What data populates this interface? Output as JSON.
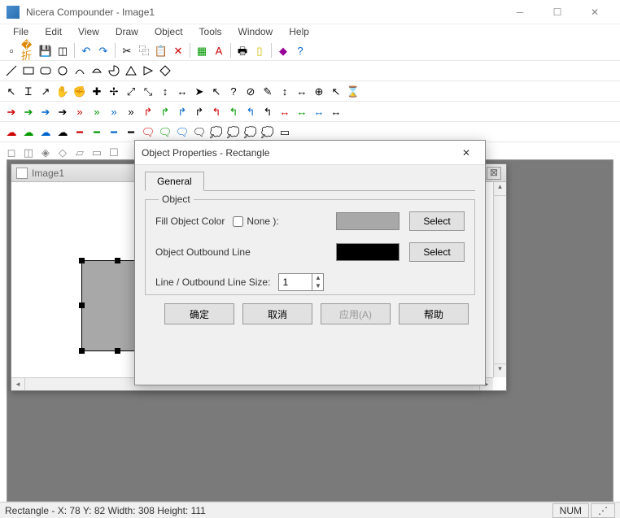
{
  "window": {
    "title": "Nicera Compounder - Image1"
  },
  "menu": {
    "items": [
      "File",
      "Edit",
      "View",
      "Draw",
      "Object",
      "Tools",
      "Window",
      "Help"
    ]
  },
  "child": {
    "title": "Image1"
  },
  "dialog": {
    "title": "Object Properties - Rectangle",
    "tab": "General",
    "fieldset": "Object",
    "fill_label": "Fill Object Color",
    "none_label": "None  ):",
    "outbound_label": "Object Outbound Line",
    "linesize_label": "Line / Outbound Line Size:",
    "linesize_value": "1",
    "select_label": "Select",
    "fill_color": "#a8a8a8",
    "line_color": "#000000",
    "buttons": {
      "ok": "确定",
      "cancel": "取消",
      "apply": "应用(A)",
      "help": "帮助"
    }
  },
  "status": {
    "left": "Rectangle - X: 78  Y: 82  Width: 308  Height: 111",
    "num": "NUM"
  }
}
